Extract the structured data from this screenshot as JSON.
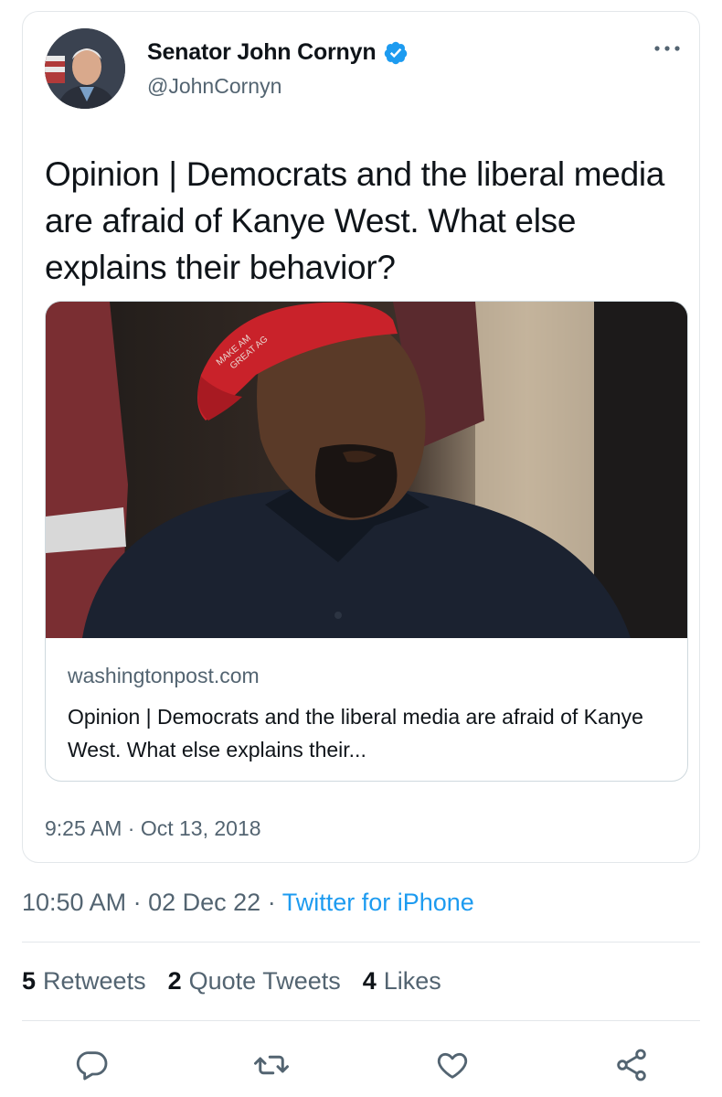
{
  "quoted_tweet": {
    "author": {
      "display_name": "Senator John Cornyn",
      "handle": "@JohnCornyn",
      "verified": true
    },
    "text": "Opinion | Democrats and the liberal media are afraid of Kanye West. What else explains their behavior?",
    "link_card": {
      "domain": "washingtonpost.com",
      "title": "Opinion | Democrats and the liberal media are afraid of Kanye West. What else explains their...",
      "image_icon": "photo-man-in-red-cap"
    },
    "timestamp": "9:25 AM · Oct 13, 2018"
  },
  "meta": {
    "time": "10:50 AM",
    "separator": "·",
    "date": "02 Dec 22",
    "source": "Twitter for iPhone"
  },
  "stats": {
    "retweets": {
      "count": "5",
      "label": "Retweets"
    },
    "quote_tweets": {
      "count": "2",
      "label": "Quote Tweets"
    },
    "likes": {
      "count": "4",
      "label": "Likes"
    }
  },
  "actions": [
    {
      "icon": "reply-icon"
    },
    {
      "icon": "retweet-icon"
    },
    {
      "icon": "like-icon"
    },
    {
      "icon": "share-icon"
    }
  ],
  "colors": {
    "link_blue": "#1d9bf0",
    "verified_blue": "#1d9bf0",
    "secondary_text": "#536471",
    "primary_text": "#0f1419",
    "border": "#e3e7ea"
  }
}
